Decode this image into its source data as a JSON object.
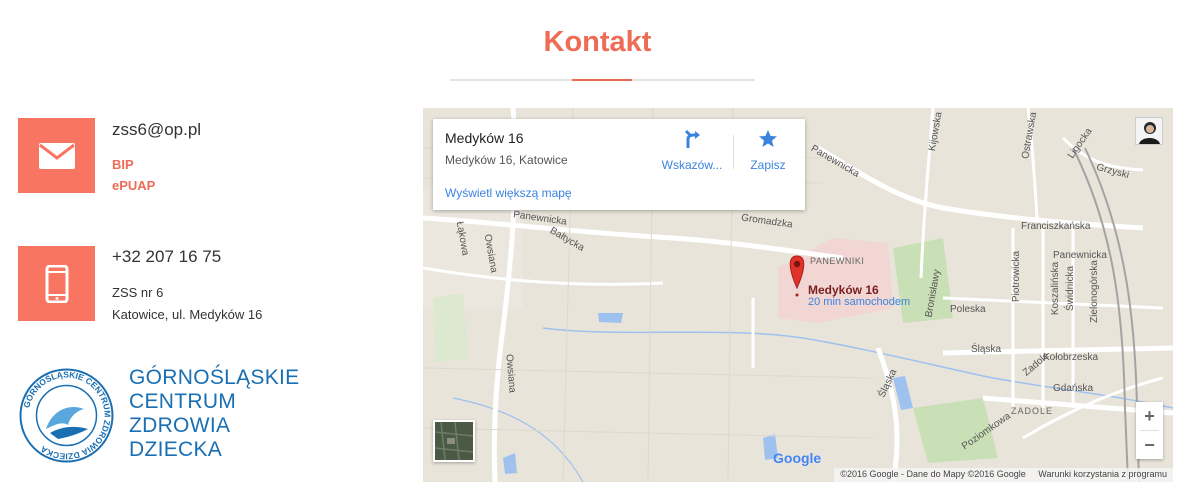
{
  "header": {
    "title": "Kontakt"
  },
  "contact": {
    "email": "zss6@op.pl",
    "links": [
      "BIP",
      "ePUAP"
    ],
    "phone": "+32 207 16 75",
    "school": "ZSS nr 6",
    "address": "Katowice, ul. Medyków 16"
  },
  "logo": {
    "lines": [
      "GÓRNOŚLĄSKIE",
      "CENTRUM",
      "ZDROWIA",
      "DZIECKA"
    ],
    "seal_text": "GÓRNOŚLĄSKIE CENTRUM ZDROWIA DZIECKA"
  },
  "map": {
    "place_name": "Medyków 16",
    "place_address": "Medyków 16, Katowice",
    "directions_label": "Wskazów...",
    "save_label": "Zapisz",
    "larger_map_link": "Wyświetl większą mapę",
    "pin_label": "Medyków 16",
    "pin_sub": "20 min samochodem",
    "district_label": "PANEWNIKI",
    "district_label_2": "ZADOLE",
    "zoom_in": "+",
    "zoom_out": "−",
    "google": "Google",
    "copyright": "©2016 Google - Dane do Mapy ©2016 Google",
    "terms": "Warunki korzystania z programu",
    "streets": {
      "lakowa": "Łąkowa",
      "owsiana1": "Owsiana",
      "owsiana2": "Owsiana",
      "panewnicka1": "Panewnicka",
      "panewnicka2": "Panewnicka",
      "panewnicka3": "Panewnicka",
      "baltycka": "Bałtycka",
      "gromadzka": "Gromadzka",
      "kijowska": "Kijowska",
      "ostrawska": "Ostrawska",
      "ligocka": "Ligocka",
      "grzyski": "Grzyski",
      "franciszkanska": "Franciszkańska",
      "bronislawy": "Bronisławy",
      "poleska": "Poleska",
      "piotrowicka": "Piotrowicka",
      "koszalinska": "Koszalińska",
      "swidnicka": "Świdnicka",
      "zielonogorska": "Zielonogórska",
      "slaska1": "Śląska",
      "slaska2": "Śląska",
      "kolobrzeska": "Kołobrzeska",
      "zadole": "Zadole",
      "gdanska": "Gdańska",
      "poziomkowa": "Poziomkowa"
    }
  },
  "colors": {
    "accent": "#f87561",
    "title": "#ee6b55",
    "logo_blue": "#1a6fb3",
    "map_link": "#3a84df"
  }
}
